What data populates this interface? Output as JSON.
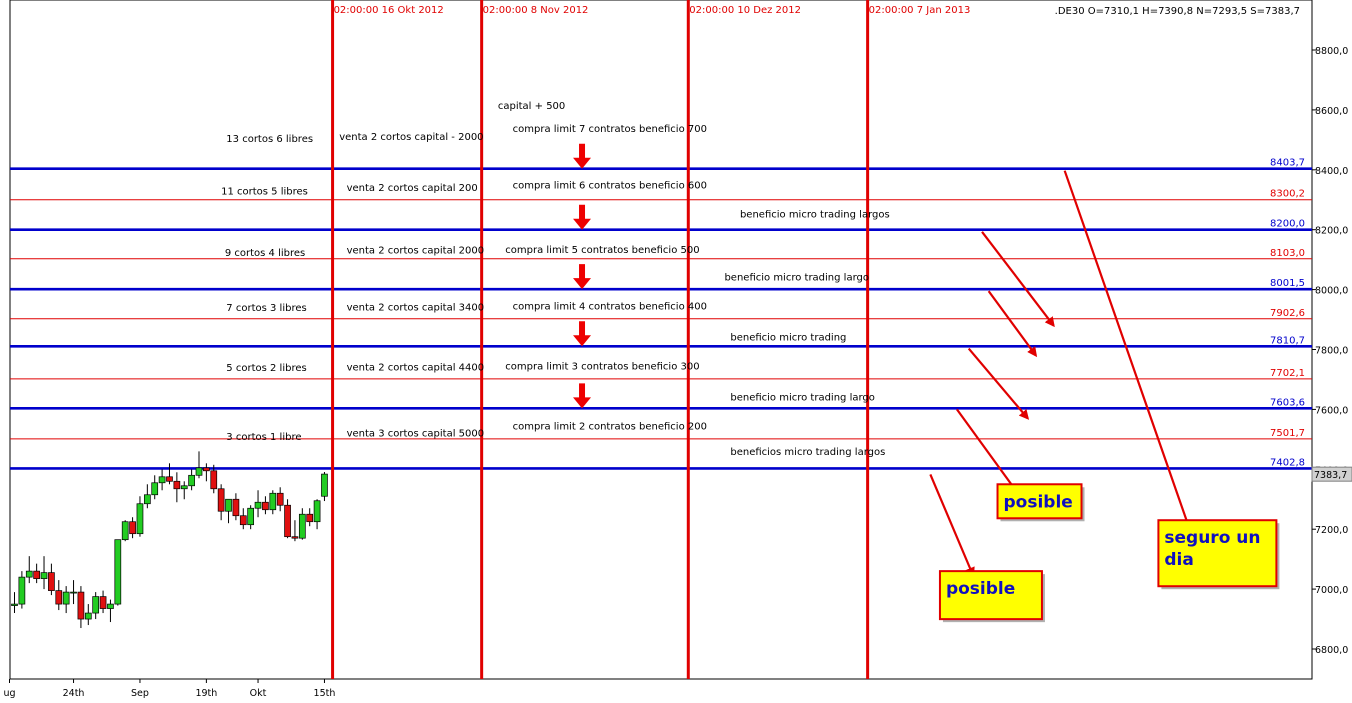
{
  "chart_data": {
    "type": "candlestick",
    "symbol_info": ".DE30 O=7310,1 H=7390,8 N=7293,5 S=7383,7",
    "y_axis": {
      "min": 6700,
      "max": 8900,
      "ticks": [
        6800,
        7000,
        7200,
        7400,
        7600,
        7800,
        8000,
        8200,
        8400,
        8600,
        8800
      ],
      "tick_labels": [
        "6800,0",
        "7000,0",
        "7200,0",
        "7400,0",
        "7600,0",
        "7800,0",
        "8000,0",
        "8200,0",
        "8400,0",
        "8600,0",
        "8800,0"
      ]
    },
    "current_price_label": "7383,7",
    "x_axis": {
      "labels": [
        "ug",
        "24th",
        "Sep",
        "19th",
        "Okt",
        "15th"
      ],
      "label_bars": [
        0,
        8,
        17,
        26,
        33,
        42
      ]
    },
    "candles": [
      {
        "o": 6945,
        "h": 6990,
        "l": 6920,
        "c": 6950
      },
      {
        "o": 6950,
        "h": 7060,
        "l": 6935,
        "c": 7040
      },
      {
        "o": 7040,
        "h": 7110,
        "l": 7020,
        "c": 7060
      },
      {
        "o": 7060,
        "h": 7085,
        "l": 7020,
        "c": 7035
      },
      {
        "o": 7035,
        "h": 7110,
        "l": 7000,
        "c": 7055
      },
      {
        "o": 7055,
        "h": 7085,
        "l": 6980,
        "c": 6995
      },
      {
        "o": 6995,
        "h": 7030,
        "l": 6930,
        "c": 6950
      },
      {
        "o": 6950,
        "h": 7010,
        "l": 6920,
        "c": 6990
      },
      {
        "o": 6990,
        "h": 7030,
        "l": 6950,
        "c": 6990
      },
      {
        "o": 6990,
        "h": 7010,
        "l": 6870,
        "c": 6900
      },
      {
        "o": 6900,
        "h": 6950,
        "l": 6880,
        "c": 6920
      },
      {
        "o": 6920,
        "h": 6990,
        "l": 6900,
        "c": 6975
      },
      {
        "o": 6975,
        "h": 6995,
        "l": 6920,
        "c": 6935
      },
      {
        "o": 6935,
        "h": 6965,
        "l": 6890,
        "c": 6950
      },
      {
        "o": 6950,
        "h": 7160,
        "l": 6945,
        "c": 7165
      },
      {
        "o": 7165,
        "h": 7230,
        "l": 7160,
        "c": 7225
      },
      {
        "o": 7225,
        "h": 7240,
        "l": 7170,
        "c": 7185
      },
      {
        "o": 7185,
        "h": 7310,
        "l": 7175,
        "c": 7285
      },
      {
        "o": 7285,
        "h": 7350,
        "l": 7270,
        "c": 7315
      },
      {
        "o": 7315,
        "h": 7380,
        "l": 7300,
        "c": 7355
      },
      {
        "o": 7355,
        "h": 7400,
        "l": 7330,
        "c": 7375
      },
      {
        "o": 7375,
        "h": 7420,
        "l": 7350,
        "c": 7360
      },
      {
        "o": 7360,
        "h": 7390,
        "l": 7290,
        "c": 7335
      },
      {
        "o": 7335,
        "h": 7360,
        "l": 7300,
        "c": 7345
      },
      {
        "o": 7345,
        "h": 7400,
        "l": 7330,
        "c": 7380
      },
      {
        "o": 7380,
        "h": 7460,
        "l": 7370,
        "c": 7405
      },
      {
        "o": 7405,
        "h": 7420,
        "l": 7360,
        "c": 7395
      },
      {
        "o": 7395,
        "h": 7415,
        "l": 7320,
        "c": 7335
      },
      {
        "o": 7335,
        "h": 7350,
        "l": 7230,
        "c": 7260
      },
      {
        "o": 7260,
        "h": 7300,
        "l": 7220,
        "c": 7300
      },
      {
        "o": 7300,
        "h": 7320,
        "l": 7230,
        "c": 7245
      },
      {
        "o": 7245,
        "h": 7270,
        "l": 7200,
        "c": 7215
      },
      {
        "o": 7215,
        "h": 7280,
        "l": 7200,
        "c": 7270
      },
      {
        "o": 7270,
        "h": 7330,
        "l": 7240,
        "c": 7290
      },
      {
        "o": 7290,
        "h": 7310,
        "l": 7250,
        "c": 7265
      },
      {
        "o": 7265,
        "h": 7330,
        "l": 7250,
        "c": 7320
      },
      {
        "o": 7320,
        "h": 7340,
        "l": 7260,
        "c": 7280
      },
      {
        "o": 7280,
        "h": 7300,
        "l": 7170,
        "c": 7175
      },
      {
        "o": 7175,
        "h": 7230,
        "l": 7160,
        "c": 7170
      },
      {
        "o": 7170,
        "h": 7270,
        "l": 7165,
        "c": 7250
      },
      {
        "o": 7250,
        "h": 7270,
        "l": 7210,
        "c": 7225
      },
      {
        "o": 7225,
        "h": 7300,
        "l": 7200,
        "c": 7295
      },
      {
        "o": 7310,
        "h": 7391,
        "l": 7294,
        "c": 7384
      }
    ],
    "vlines": [
      {
        "label": "02:00:00 16 Okt 2012",
        "bar": 43.1
      },
      {
        "label": "02:00:00 8 Nov 2012",
        "bar": 63.3
      },
      {
        "label": "02:00:00 10 Dez 2012",
        "bar": 91.3
      },
      {
        "label": "02:00:00 7 Jan 2013",
        "bar": 115.6
      }
    ],
    "levels": [
      {
        "value": 8403.7,
        "label": "8403,7",
        "color": "#0000cc",
        "major": true
      },
      {
        "value": 8300.2,
        "label": "8300,2",
        "color": "#e00000",
        "major": false
      },
      {
        "value": 8200.0,
        "label": "8200,0",
        "color": "#0000cc",
        "major": true
      },
      {
        "value": 8103.0,
        "label": "8103,0",
        "color": "#e00000",
        "major": false
      },
      {
        "value": 8001.5,
        "label": "8001,5",
        "color": "#0000cc",
        "major": true
      },
      {
        "value": 7902.6,
        "label": "7902,6",
        "color": "#e00000",
        "major": false
      },
      {
        "value": 7810.7,
        "label": "7810,7",
        "color": "#0000cc",
        "major": true
      },
      {
        "value": 7702.1,
        "label": "7702,1",
        "color": "#e00000",
        "major": false
      },
      {
        "value": 7603.6,
        "label": "7603,6",
        "color": "#0000cc",
        "major": true
      },
      {
        "value": 7501.7,
        "label": "7501,7",
        "color": "#e00000",
        "major": false
      },
      {
        "value": 7402.8,
        "label": "7402,8",
        "color": "#0000cc",
        "major": true
      }
    ],
    "annotations": [
      {
        "text": "13 cortos 6 libres",
        "bar": 28.7,
        "price": 8493
      },
      {
        "text": "11 cortos  5 libres",
        "bar": 28.0,
        "price": 8318
      },
      {
        "text": "9 cortos 4 libres",
        "bar": 28.5,
        "price": 8113
      },
      {
        "text": "7 cortos 3 libres",
        "bar": 28.7,
        "price": 7928
      },
      {
        "text": "5 cortos  2 libres",
        "bar": 28.7,
        "price": 7728
      },
      {
        "text": "3 cortos  1 libre",
        "bar": 28.7,
        "price": 7498
      },
      {
        "text": "venta 2 cortos  capital  - 2000",
        "bar": 44.0,
        "price": 8500
      },
      {
        "text": "venta 2 cortos  capital  200",
        "bar": 45.0,
        "price": 8330
      },
      {
        "text": "venta 2 cortos  capital 2000",
        "bar": 45.0,
        "price": 8120
      },
      {
        "text": "venta 2 cortos  capital 3400",
        "bar": 45.0,
        "price": 7930
      },
      {
        "text": "venta 2 cortos  capital 4400",
        "bar": 45.0,
        "price": 7730
      },
      {
        "text": "venta 3 cortos  capital 5000",
        "bar": 45.0,
        "price": 7510
      },
      {
        "text": "capital  + 500",
        "bar": 65.5,
        "price": 8603
      },
      {
        "text": "compra limit 7 contratos beneficio 700",
        "bar": 67.5,
        "price": 8527
      },
      {
        "text": "compra limit 6 contratos beneficio 600",
        "bar": 67.5,
        "price": 8337
      },
      {
        "text": "compra limit 5 contratos beneficio 500",
        "bar": 66.5,
        "price": 8123
      },
      {
        "text": "compra limit 4 contratos beneficio 400",
        "bar": 67.5,
        "price": 7933
      },
      {
        "text": "compra limit 3 contratos beneficio 300",
        "bar": 66.5,
        "price": 7733
      },
      {
        "text": "compra limit 2 contratos beneficio 200",
        "bar": 67.5,
        "price": 7533
      },
      {
        "text": "beneficio micro trading largos",
        "bar": 98.3,
        "price": 8240
      },
      {
        "text": "beneficio micro trading largo",
        "bar": 96.2,
        "price": 8030
      },
      {
        "text": "beneficio micro trading",
        "bar": 97.0,
        "price": 7830
      },
      {
        "text": "beneficio micro trading largo",
        "bar": 97.0,
        "price": 7630
      },
      {
        "text": "beneficios micro trading largos",
        "bar": 97.0,
        "price": 7447
      }
    ],
    "down_arrows": [
      {
        "bar": 76.9,
        "price": 8403.7
      },
      {
        "bar": 76.9,
        "price": 8200.0
      },
      {
        "bar": 76.9,
        "price": 8001.5
      },
      {
        "bar": 76.9,
        "price": 7810.7
      },
      {
        "bar": 76.9,
        "price": 7603.6
      }
    ],
    "diagonal_arrows": [
      {
        "from": {
          "bar": 142.3,
          "price": 8397
        },
        "to": {
          "bar": 159.8,
          "price": 7160
        }
      },
      {
        "from": {
          "bar": 131.1,
          "price": 8193
        },
        "to": {
          "bar": 140.8,
          "price": 7880
        }
      },
      {
        "from": {
          "bar": 132.0,
          "price": 7995
        },
        "to": {
          "bar": 138.4,
          "price": 7780
        }
      },
      {
        "from": {
          "bar": 129.3,
          "price": 7803
        },
        "to": {
          "bar": 137.3,
          "price": 7570
        }
      },
      {
        "from": {
          "bar": 127.7,
          "price": 7600
        },
        "to": {
          "bar": 136.1,
          "price": 7315
        }
      },
      {
        "from": {
          "bar": 124.1,
          "price": 7383
        },
        "to": {
          "bar": 129.9,
          "price": 7045
        }
      }
    ],
    "note_boxes": [
      {
        "lines": [
          "posible"
        ],
        "bar": 133.2,
        "price": 7350,
        "w": 84,
        "h": 34
      },
      {
        "lines": [
          "seguro un",
          "dia"
        ],
        "bar": 155.0,
        "price": 7230,
        "w": 118,
        "h": 66
      },
      {
        "lines": [
          "posible"
        ],
        "bar": 125.4,
        "price": 7060,
        "w": 102,
        "h": 48
      }
    ]
  }
}
